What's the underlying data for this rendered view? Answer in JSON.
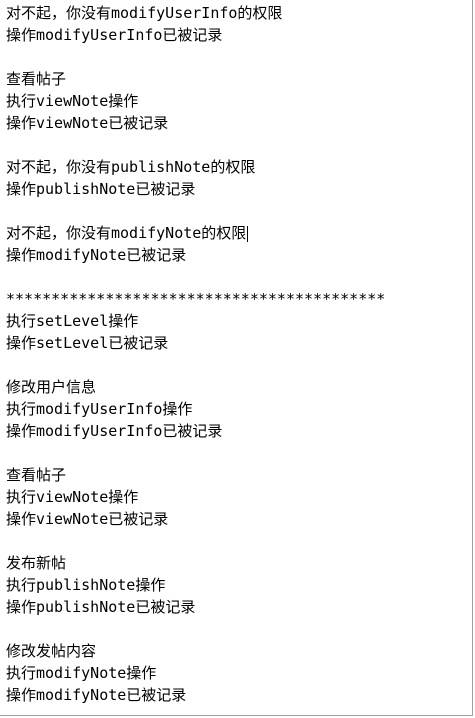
{
  "console": {
    "lines": [
      "对不起，你没有modifyUserInfo的权限",
      "操作modifyUserInfo已被记录",
      "",
      "查看帖子",
      "执行viewNote操作",
      "操作viewNote已被记录",
      "",
      "对不起，你没有publishNote的权限",
      "操作publishNote已被记录",
      "",
      "对不起，你没有modifyNote的权限",
      "操作modifyNote已被记录",
      "",
      "******************************************",
      "执行setLevel操作",
      "操作setLevel已被记录",
      "",
      "修改用户信息",
      "执行modifyUserInfo操作",
      "操作modifyUserInfo已被记录",
      "",
      "查看帖子",
      "执行viewNote操作",
      "操作viewNote已被记录",
      "",
      "发布新帖",
      "执行publishNote操作",
      "操作publishNote已被记录",
      "",
      "修改发帖内容",
      "执行modifyNote操作",
      "操作modifyNote已被记录"
    ]
  }
}
